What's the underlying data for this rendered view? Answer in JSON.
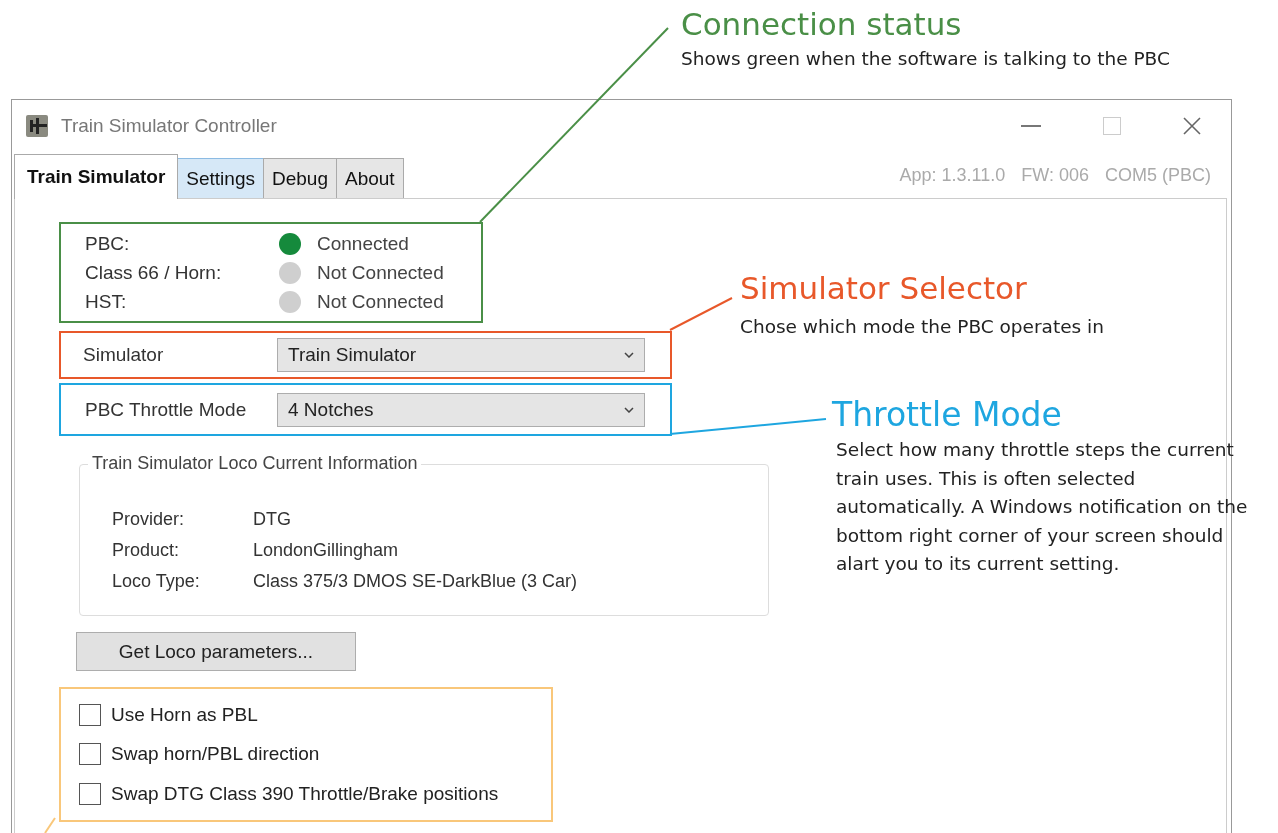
{
  "window": {
    "title": "Train Simulator Controller"
  },
  "tabs": [
    {
      "label": "Train Simulator",
      "selected": true,
      "hovered": false
    },
    {
      "label": "Settings",
      "selected": false,
      "hovered": true
    },
    {
      "label": "Debug",
      "selected": false,
      "hovered": false
    },
    {
      "label": "About",
      "selected": false,
      "hovered": false
    }
  ],
  "version_info": [
    "App: 1.3.11.0",
    "FW: 006",
    "COM5 (PBC)"
  ],
  "connections": [
    {
      "label": "PBC:",
      "status": "Connected",
      "connected": true
    },
    {
      "label": "Class 66 / Horn:",
      "status": "Not Connected",
      "connected": false
    },
    {
      "label": "HST:",
      "status": "Not Connected",
      "connected": false
    }
  ],
  "simulator": {
    "label": "Simulator",
    "value": "Train Simulator"
  },
  "throttle_mode": {
    "label": "PBC Throttle Mode",
    "value": "4 Notches"
  },
  "loco_info": {
    "title": "Train Simulator Loco Current Information",
    "rows": [
      {
        "label": "Provider:",
        "value": "DTG"
      },
      {
        "label": "Product:",
        "value": "LondonGillingham"
      },
      {
        "label": "Loco Type:",
        "value": "Class 375/3 DMOS SE-DarkBlue (3 Car)"
      }
    ]
  },
  "get_params_button": "Get Loco parameters...",
  "options": [
    {
      "label": "Use Horn as PBL",
      "checked": false
    },
    {
      "label": "Swap horn/PBL direction",
      "checked": false
    },
    {
      "label": "Swap DTG Class 390 Throttle/Brake positions",
      "checked": false
    }
  ],
  "annotations": [
    {
      "kind": "connection",
      "title": "Connection status",
      "text": "Shows green when the software is talking to the PBC",
      "color": "#4a8f47"
    },
    {
      "kind": "simulator",
      "title": "Simulator Selector",
      "text": "Chose which mode the PBC operates in",
      "color": "#e8582a"
    },
    {
      "kind": "throttle",
      "title": "Throttle Mode",
      "text": "Select how many throttle steps the current train uses. This is often selected automatically. A Windows notification on the bottom right corner of your screen should alart you to its current setting.",
      "color": "#1ea6e0"
    },
    {
      "kind": "options",
      "color": "#f9c77a"
    }
  ]
}
